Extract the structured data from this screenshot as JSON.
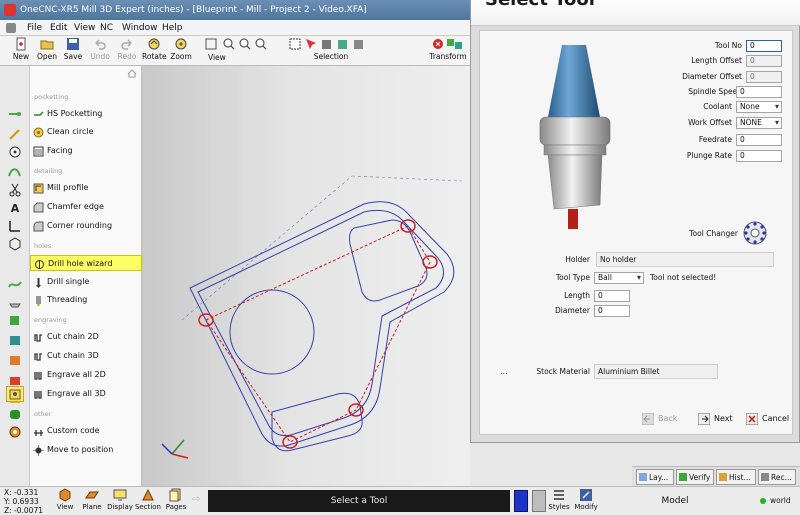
{
  "window": {
    "title": "OneCNC-XR5 Mill 3D Expert (inches) - [Blueprint - Mill - Project 2 - Video.XFA]"
  },
  "menu": {
    "items": [
      "File",
      "Edit",
      "View",
      "NC",
      "Window",
      "Help"
    ]
  },
  "toolbar": {
    "new": "New",
    "open": "Open",
    "save": "Save",
    "undo": "Undo",
    "redo": "Redo",
    "rotate": "Rotate",
    "zoom": "Zoom",
    "view": "View",
    "selection": "Selection",
    "transform": "Transform"
  },
  "operations": {
    "sections": [
      "pocketting",
      "detailing",
      "holes",
      "engraving",
      "other"
    ],
    "items": [
      "HS Pocketting",
      "Clean circle",
      "Facing",
      "Mill profile",
      "Chamfer edge",
      "Corner rounding",
      "Drill hole wizard",
      "Drill single",
      "Threading",
      "Cut chain 2D",
      "Cut chain 3D",
      "Engrave all 2D",
      "Engrave all 3D",
      "Custom code",
      "Move to position"
    ]
  },
  "dialog": {
    "title": "Select Tool",
    "fields": {
      "tool_no_label": "Tool No",
      "tool_no": "0",
      "length_offset_label": "Length Offset",
      "length_offset": "0",
      "diameter_offset_label": "Diameter Offset",
      "diameter_offset": "0",
      "spindle_speed_label": "Spindle Speed",
      "spindle_speed": "0",
      "coolant_label": "Coolant",
      "coolant": "None",
      "work_offset_label": "Work Offset",
      "work_offset": "NONE",
      "feedrate_label": "Feedrate",
      "feedrate": "0",
      "plunge_rate_label": "Plunge Rate",
      "plunge_rate": "0",
      "tool_changer_label": "Tool Changer",
      "holder_label": "Holder",
      "holder": "No holder",
      "tool_type_label": "Tool Type",
      "tool_type": "Ball",
      "tool_warning": "Tool not selected!",
      "length_label": "Length",
      "length": "0",
      "diameter_label": "Diameter",
      "diameter": "0",
      "stock_ellipsis": "...",
      "stock_material_label": "Stock Material",
      "stock_material": "Aluminium Billet"
    },
    "buttons": {
      "back": "Back",
      "next": "Next",
      "cancel": "Cancel"
    }
  },
  "panel_tabs": [
    "Lay...",
    "Verify",
    "Hist...",
    "Rec..."
  ],
  "status": {
    "x": "X: -0.331",
    "y": "Y: 0.6933",
    "z": "Z: -0.0071",
    "view": "View",
    "plane": "Plane",
    "display": "Display",
    "section": "Section",
    "pages": "Pages",
    "prompt": "Select a Tool",
    "styles": "Styles",
    "modify": "Modify",
    "model": "Model",
    "world": "world"
  },
  "colors": {
    "accent": "#1d34c9",
    "highlight": "#ffff66",
    "contour": "#3340b0",
    "holes": "#cc1f1f"
  }
}
